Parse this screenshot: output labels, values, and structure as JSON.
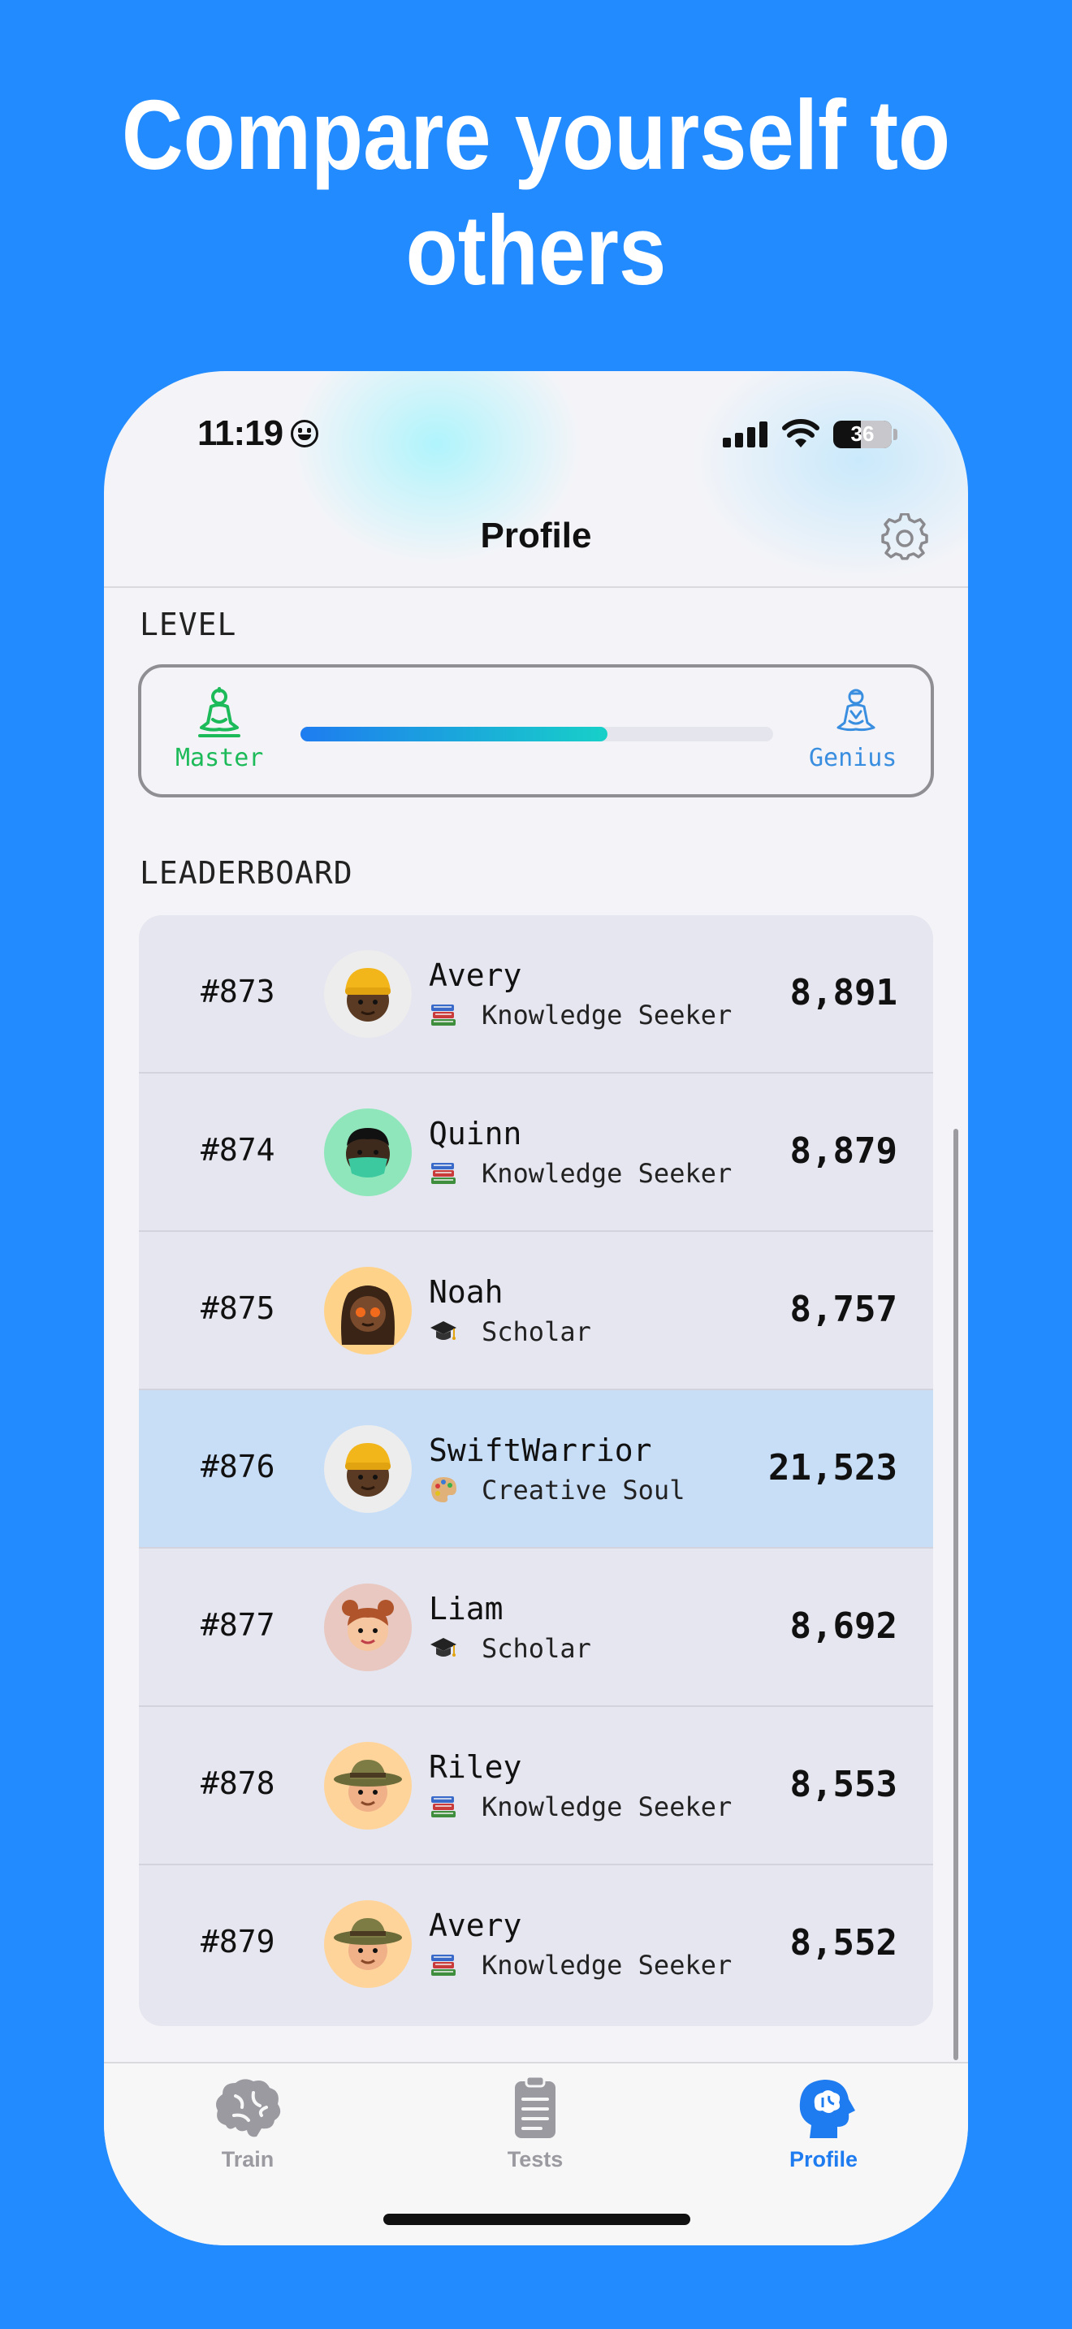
{
  "headline": "Compare yourself to others",
  "status_bar": {
    "time": "11:19",
    "battery": "36"
  },
  "nav": {
    "title": "Profile"
  },
  "level": {
    "section_label": "LEVEL",
    "current_label": "Master",
    "next_label": "Genius",
    "progress": 0.65
  },
  "leaderboard": {
    "section_label": "LEADERBOARD",
    "rows": [
      {
        "rank": "#873",
        "name": "Avery",
        "title": "Knowledge Seeker",
        "score": "8,891",
        "badge_icon": "books-icon",
        "avatar": "yellow-beanie-avatar",
        "highlighted": false
      },
      {
        "rank": "#874",
        "name": "Quinn",
        "title": "Knowledge Seeker",
        "score": "8,879",
        "badge_icon": "books-icon",
        "avatar": "mask-avatar",
        "highlighted": false
      },
      {
        "rank": "#875",
        "name": "Noah",
        "title": "Scholar",
        "score": "8,757",
        "badge_icon": "graduation-cap-icon",
        "avatar": "star-eyes-avatar",
        "highlighted": false
      },
      {
        "rank": "#876",
        "name": "SwiftWarrior",
        "title": "Creative Soul",
        "score": "21,523",
        "badge_icon": "palette-icon",
        "avatar": "yellow-beanie-avatar",
        "highlighted": true
      },
      {
        "rank": "#877",
        "name": "Liam",
        "title": "Scholar",
        "score": "8,692",
        "badge_icon": "graduation-cap-icon",
        "avatar": "buns-avatar",
        "highlighted": false
      },
      {
        "rank": "#878",
        "name": "Riley",
        "title": "Knowledge Seeker",
        "score": "8,553",
        "badge_icon": "books-icon",
        "avatar": "safari-hat-avatar",
        "highlighted": false
      },
      {
        "rank": "#879",
        "name": "Avery",
        "title": "Knowledge Seeker",
        "score": "8,552",
        "badge_icon": "books-icon",
        "avatar": "safari-hat-avatar",
        "highlighted": false
      }
    ]
  },
  "tabs": [
    {
      "label": "Train",
      "icon": "brain-icon",
      "active": false
    },
    {
      "label": "Tests",
      "icon": "clipboard-icon",
      "active": false
    },
    {
      "label": "Profile",
      "icon": "head-brain-icon",
      "active": true
    }
  ],
  "colors": {
    "background": "#228BFF",
    "accent": "#1E7CF0",
    "master_green": "#1DBA5A",
    "genius_blue": "#3A8EE0",
    "highlight_row": "#C8DEF7",
    "inactive_tab": "#9A9AA0"
  }
}
